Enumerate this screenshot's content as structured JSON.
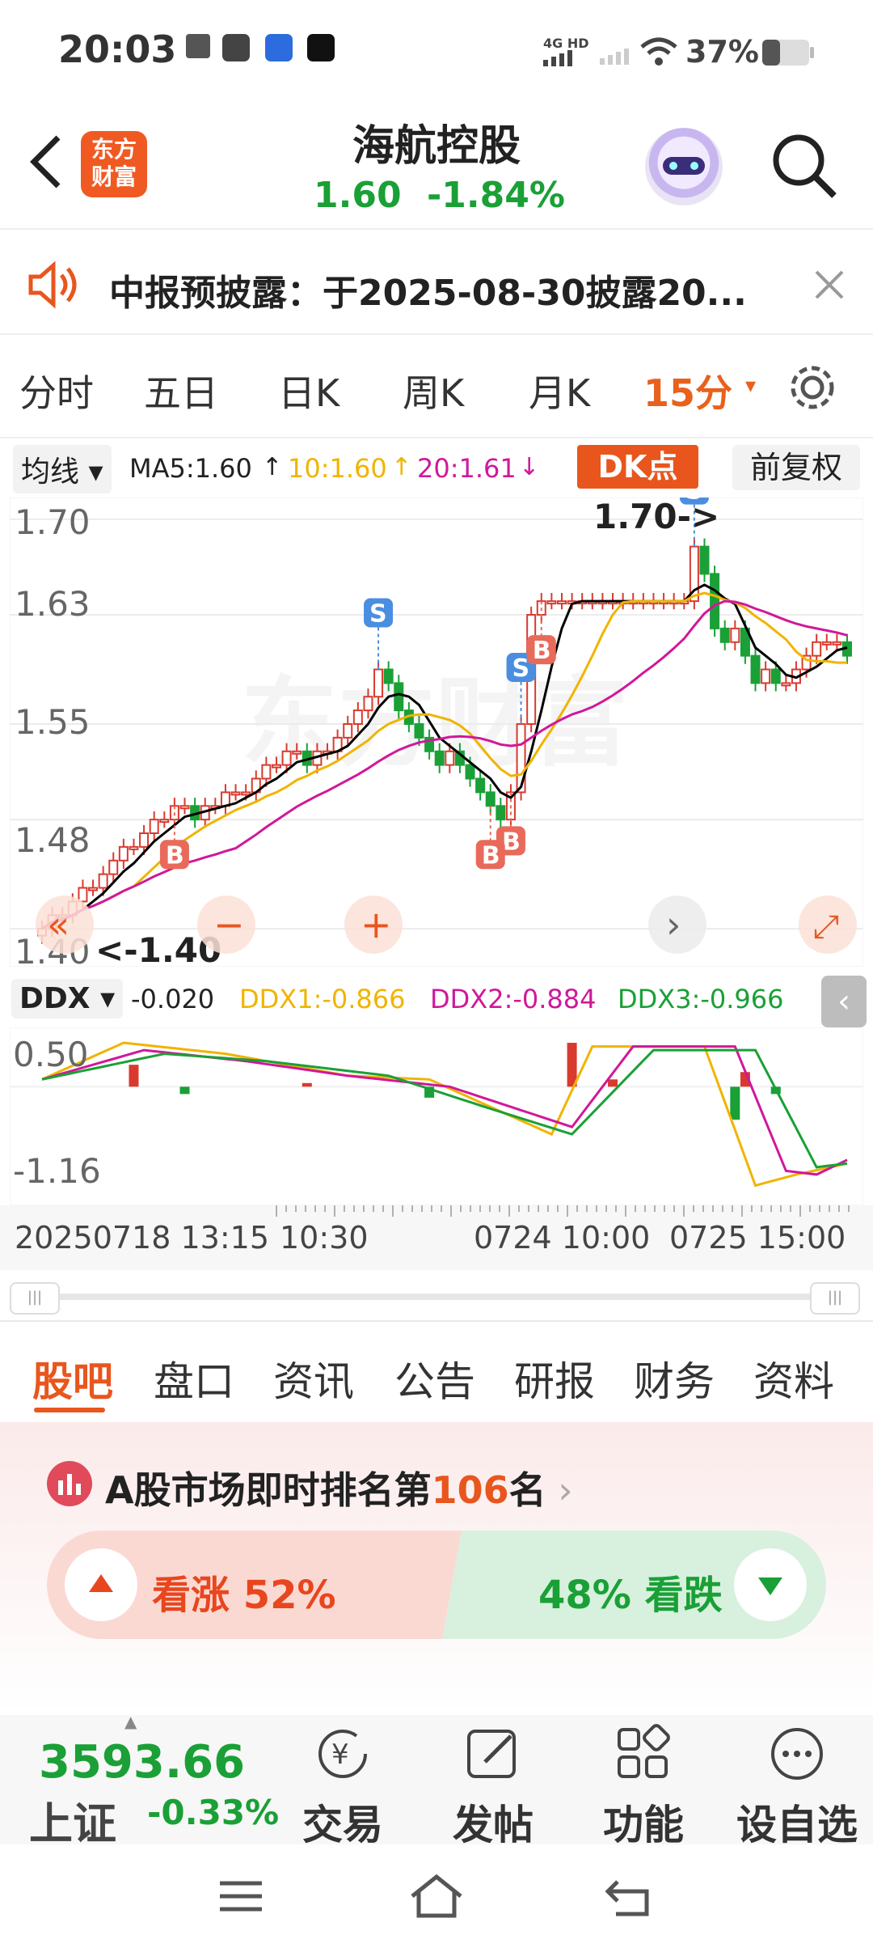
{
  "status_bar": {
    "time": "20:03",
    "battery": "37%",
    "network": "4G HD"
  },
  "header": {
    "logo_line1": "东方",
    "logo_line2": "财富",
    "stock_name": "海航控股",
    "price": "1.60",
    "change": "-1.84%",
    "accent": "#e8561e",
    "down_color": "#1aa036"
  },
  "notice": {
    "text": "中报预披露：于2025-08-30披露20..."
  },
  "period_tabs": [
    "分时",
    "五日",
    "日K",
    "周K",
    "月K",
    "15分"
  ],
  "active_period": "15分",
  "indicators": {
    "selector": "均线",
    "ma5": "MA5:1.60",
    "ma10": "10:1.60",
    "ma20": "20:1.61",
    "dk_button": "DK点",
    "adjust_button": "前复权"
  },
  "chart_data": [
    {
      "type": "candlestick",
      "title": "",
      "y_ticks": [
        "1.70",
        "1.63",
        "1.55",
        "1.48",
        "1.40"
      ],
      "ylim": [
        1.39,
        1.71
      ],
      "annotations": [
        "1.70->",
        "<-1.40"
      ],
      "signals": [
        "B",
        "S",
        "S",
        "B",
        "B",
        "B",
        "S"
      ],
      "series": [
        {
          "name": "MA5",
          "color": "#000000"
        },
        {
          "name": "10",
          "color": "#f0b400"
        },
        {
          "name": "20",
          "color": "#d0189a"
        }
      ],
      "close": [
        1.4,
        1.41,
        1.41,
        1.42,
        1.43,
        1.43,
        1.44,
        1.45,
        1.46,
        1.46,
        1.47,
        1.48,
        1.48,
        1.49,
        1.49,
        1.48,
        1.49,
        1.49,
        1.5,
        1.5,
        1.5,
        1.51,
        1.52,
        1.52,
        1.53,
        1.53,
        1.52,
        1.53,
        1.53,
        1.54,
        1.55,
        1.56,
        1.57,
        1.59,
        1.58,
        1.56,
        1.55,
        1.54,
        1.53,
        1.52,
        1.53,
        1.52,
        1.51,
        1.5,
        1.49,
        1.48,
        1.5,
        1.55,
        1.63,
        1.64,
        1.64,
        1.64,
        1.64,
        1.64,
        1.64,
        1.64,
        1.64,
        1.64,
        1.64,
        1.64,
        1.64,
        1.64,
        1.64,
        1.64,
        1.68,
        1.66,
        1.62,
        1.61,
        1.62,
        1.6,
        1.58,
        1.59,
        1.58,
        1.58,
        1.59,
        1.6,
        1.61,
        1.61,
        1.61,
        1.6
      ]
    },
    {
      "type": "line",
      "title": "DDX",
      "y_ticks": [
        "0.50",
        "-1.16"
      ],
      "ylim": [
        -1.3,
        0.8
      ],
      "labels": {
        "ddx": "-0.020",
        "ddx1": "DDX1:-0.866",
        "ddx2": "DDX2:-0.884",
        "ddx3": "DDX3:-0.966"
      },
      "series": [
        {
          "name": "DDX1",
          "color": "#f0b400"
        },
        {
          "name": "DDX2",
          "color": "#d0189a"
        },
        {
          "name": "DDX3",
          "color": "#1aa036"
        }
      ]
    }
  ],
  "ddx": {
    "selector": "DDX",
    "value": "-0.020",
    "ddx1": "DDX1:-0.866",
    "ddx2": "DDX2:-0.884",
    "ddx3": "DDX3:-0.966"
  },
  "chart_controls": [
    "«",
    "−",
    "+",
    "›",
    "⤢"
  ],
  "x_labels": {
    "start": "20250718 13:15",
    "partial": "10:30",
    "mid": "0724 10:00",
    "end": "0725 15:00"
  },
  "bottom_tabs": [
    "股吧",
    "盘口",
    "资讯",
    "公告",
    "研报",
    "财务",
    "资料"
  ],
  "active_bottom_tab": "股吧",
  "rank": {
    "prefix": "A股市场即时排名第",
    "number": "106",
    "suffix": "名"
  },
  "vote": {
    "up_label": "看涨 52%",
    "down_label": "48% 看跌",
    "up_fraction": 0.52
  },
  "bottom_nav": {
    "index_value": "3593.66",
    "index_name": "上证",
    "index_change": "-0.33%",
    "items": [
      "交易",
      "发帖",
      "功能",
      "设自选"
    ]
  }
}
